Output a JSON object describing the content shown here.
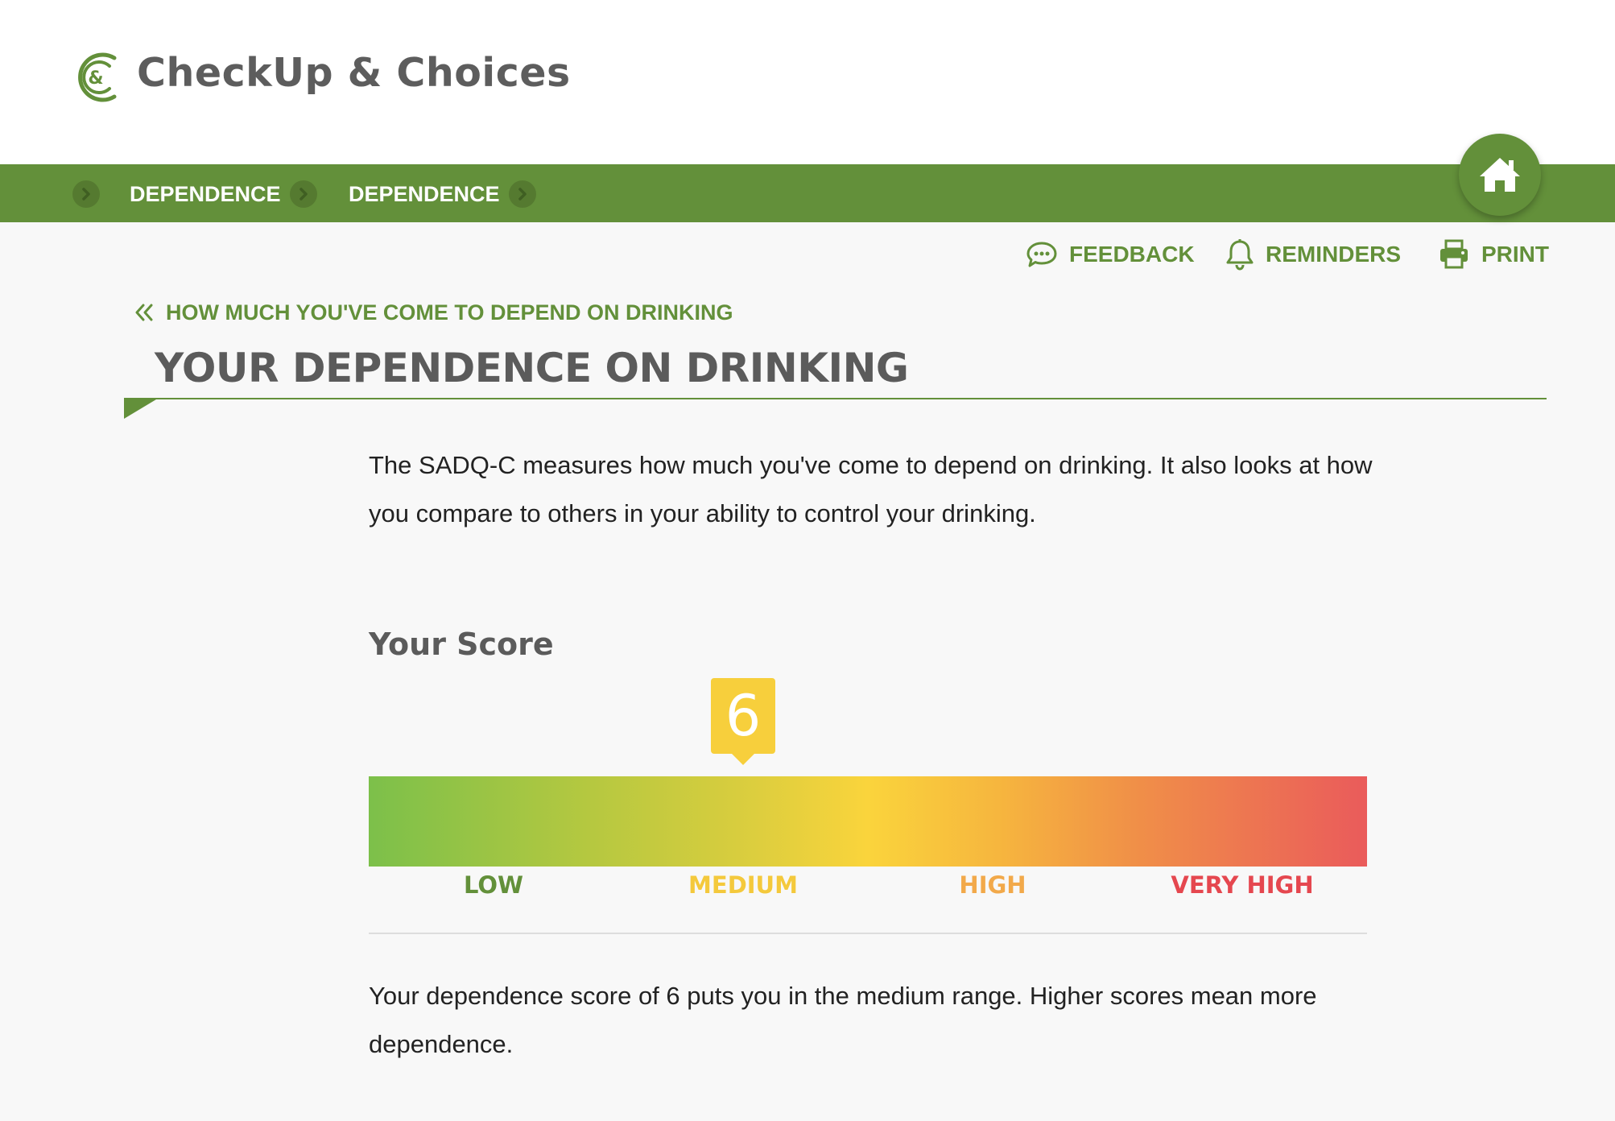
{
  "brand": {
    "name": "CheckUp & Choices",
    "mark_text": "&",
    "color": "#63903a"
  },
  "breadcrumb": {
    "items": [
      {
        "label": "DEPENDENCE"
      },
      {
        "label": "DEPENDENCE"
      }
    ],
    "separator_icon": "chevron-right-circle-icon"
  },
  "home_button": {
    "icon": "home-icon"
  },
  "utility_nav": {
    "feedback": {
      "label": "FEEDBACK",
      "icon": "speech-bubble-icon"
    },
    "reminders": {
      "label": "REMINDERS",
      "icon": "bell-icon"
    },
    "print": {
      "label": "PRINT",
      "icon": "printer-icon"
    }
  },
  "back_link": {
    "label": "HOW MUCH YOU'VE COME TO DEPEND ON DRINKING",
    "icon": "double-chevron-left-icon"
  },
  "page_title": "YOUR DEPENDENCE ON DRINKING",
  "intro": "The SADQ-C measures how much you've come to depend on drinking. It also looks at how you compare to others in your ability to control your drinking.",
  "score": {
    "heading": "Your Score",
    "value": "6",
    "marker_position": 0.375,
    "marker_color": "#f7cf3c",
    "ranges": [
      {
        "label": "LOW",
        "color": "#63903a"
      },
      {
        "label": "MEDIUM",
        "color": "#f4c93c"
      },
      {
        "label": "HIGH",
        "color": "#f2a94a"
      },
      {
        "label": "VERY HIGH",
        "color": "#e5474f"
      }
    ]
  },
  "result_text": "Your dependence score of 6 puts you in the medium range. Higher scores mean more dependence."
}
